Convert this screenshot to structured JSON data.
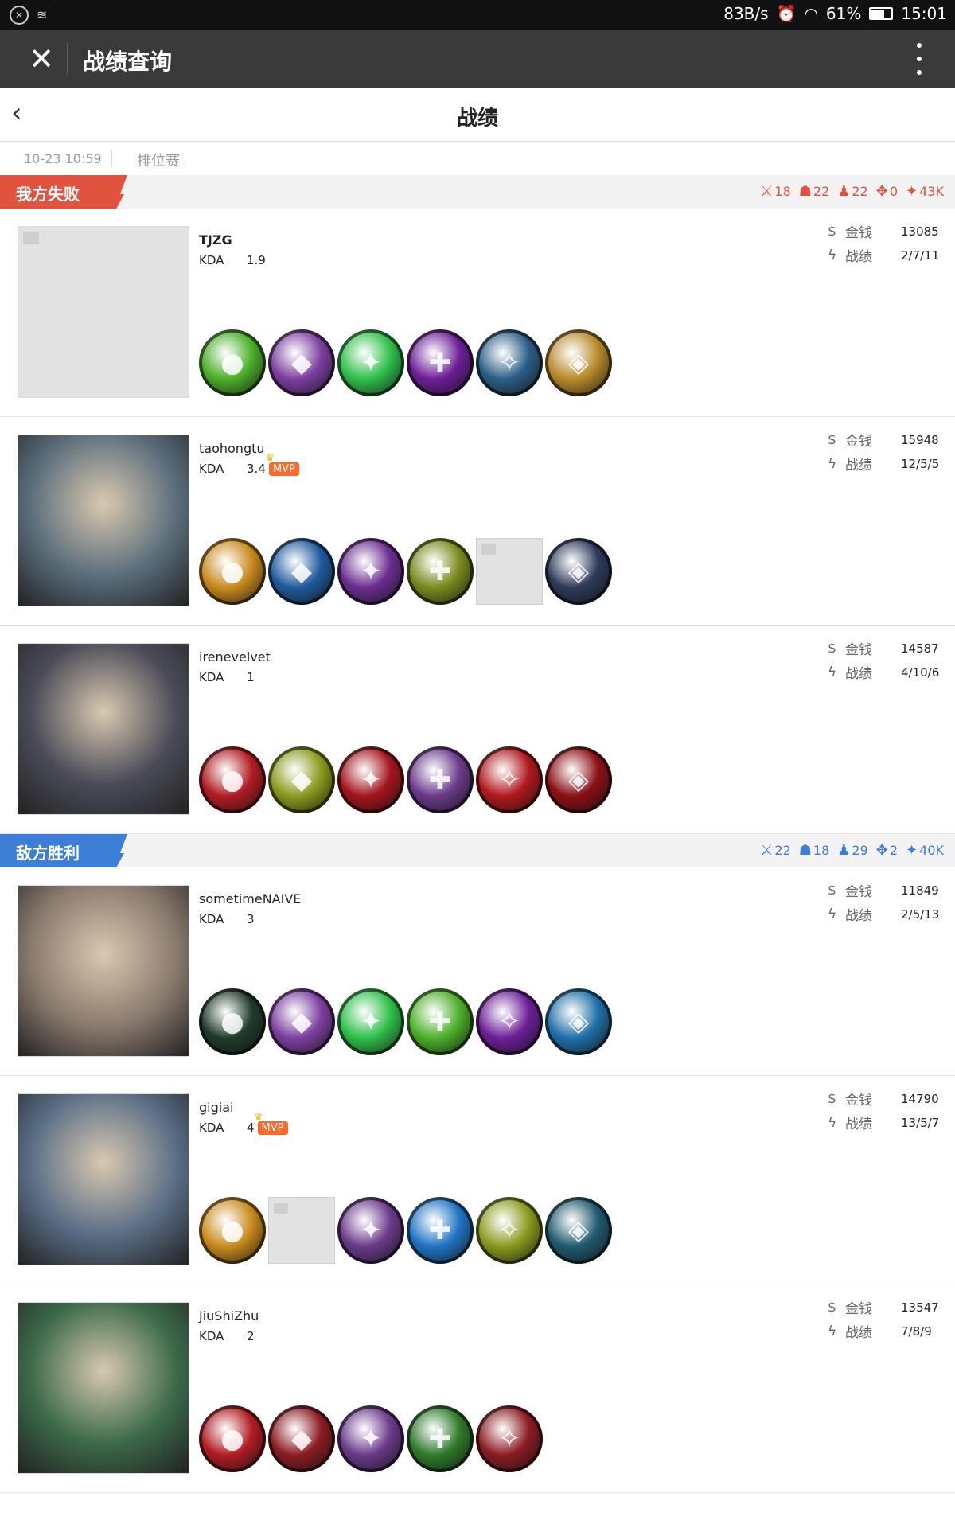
{
  "status_bar": {
    "net_speed": "83B/s",
    "battery": "61%",
    "time": "15:01"
  },
  "app_bar": {
    "close_icon": "close-icon",
    "title": "战绩查询",
    "more_icon": "more-vertical-icon"
  },
  "page": {
    "back_icon": "chevron-left-icon",
    "title": "战绩"
  },
  "match": {
    "datetime": "10-23 10:59",
    "mode": "排位赛"
  },
  "teams": [
    {
      "label": "我方失败",
      "result": "lose",
      "color": "#e2533f",
      "stats": [
        {
          "icon": "sword-icon",
          "value": "18"
        },
        {
          "icon": "monster-icon",
          "value": "22"
        },
        {
          "icon": "person-icon",
          "value": "22"
        },
        {
          "icon": "tower-icon",
          "value": "0"
        },
        {
          "icon": "gold-icon",
          "value": "43K"
        }
      ],
      "players": [
        {
          "name": "TJZG",
          "bold": true,
          "kda_label": "KDA",
          "kda": "1.9",
          "mvp": false,
          "money_label": "金钱",
          "money": "13085",
          "record_label": "战绩",
          "record": "2/7/11",
          "avatar": "placeholder",
          "items": [
            {
              "color": "#4caf2a"
            },
            {
              "color": "#7c3fa0"
            },
            {
              "color": "#2fbf4a"
            },
            {
              "color": "#6b1f96"
            },
            {
              "color": "#2a5e86"
            },
            {
              "color": "#b88a2a"
            }
          ]
        },
        {
          "name": "taohongtu",
          "bold": false,
          "kda_label": "KDA",
          "kda": "3.4",
          "mvp": true,
          "mvp_label": "MVP",
          "money_label": "金钱",
          "money": "15948",
          "record_label": "战绩",
          "record": "12/5/5",
          "avatar": "#5b6e7c",
          "items": [
            {
              "color": "#c98a1e"
            },
            {
              "color": "#1f5a9c"
            },
            {
              "color": "#6a2d8f"
            },
            {
              "color": "#7a8a1e"
            },
            {
              "placeholder": true
            },
            {
              "color": "#2d3a5a"
            }
          ]
        },
        {
          "name": "irenevelvet",
          "bold": false,
          "kda_label": "KDA",
          "kda": "1",
          "mvp": false,
          "money_label": "金钱",
          "money": "14587",
          "record_label": "战绩",
          "record": "4/10/6",
          "avatar": "#4a4b57",
          "items": [
            {
              "color": "#b01c22"
            },
            {
              "color": "#8a9a1e"
            },
            {
              "color": "#a3141d"
            },
            {
              "color": "#6a3a8a"
            },
            {
              "color": "#b0181e"
            },
            {
              "color": "#8a0f15"
            }
          ]
        }
      ]
    },
    {
      "label": "敌方胜利",
      "result": "win",
      "color": "#3d7fd6",
      "stats": [
        {
          "icon": "sword-icon",
          "value": "22"
        },
        {
          "icon": "monster-icon",
          "value": "18"
        },
        {
          "icon": "person-icon",
          "value": "29"
        },
        {
          "icon": "tower-icon",
          "value": "2"
        },
        {
          "icon": "gold-icon",
          "value": "40K"
        }
      ],
      "players": [
        {
          "name": "sometimeNAIVE",
          "bold": false,
          "kda_label": "KDA",
          "kda": "3",
          "mvp": false,
          "money_label": "金钱",
          "money": "11849",
          "record_label": "战绩",
          "record": "2/5/13",
          "avatar": "#8a7a6e",
          "items": [
            {
              "color": "#1f3a2a"
            },
            {
              "color": "#7c3fa0"
            },
            {
              "color": "#2fbf4a"
            },
            {
              "color": "#4caf2a"
            },
            {
              "color": "#6b1f96"
            },
            {
              "color": "#1f6fa8"
            }
          ]
        },
        {
          "name": "gigiai",
          "bold": false,
          "kda_label": "KDA",
          "kda": "4",
          "mvp": true,
          "mvp_label": "MVP",
          "money_label": "金钱",
          "money": "14790",
          "record_label": "战绩",
          "record": "13/5/7",
          "avatar": "#5a6e86",
          "items": [
            {
              "color": "#c98a1e"
            },
            {
              "placeholder": true
            },
            {
              "color": "#6a3a8a"
            },
            {
              "color": "#1f74c2"
            },
            {
              "color": "#8a9a1e"
            },
            {
              "color": "#1f5a6e"
            }
          ]
        },
        {
          "name": "JiuShiZhu",
          "bold": false,
          "kda_label": "KDA",
          "kda": "2",
          "mvp": false,
          "money_label": "金钱",
          "money": "13547",
          "record_label": "战绩",
          "record": "7/8/9",
          "avatar": "#3c6a4a",
          "items": [
            {
              "color": "#b01c22"
            },
            {
              "color": "#8a1c22"
            },
            {
              "color": "#6a3a8a"
            },
            {
              "color": "#2e7a2a"
            },
            {
              "color": "#8a1c22"
            }
          ]
        }
      ]
    }
  ]
}
